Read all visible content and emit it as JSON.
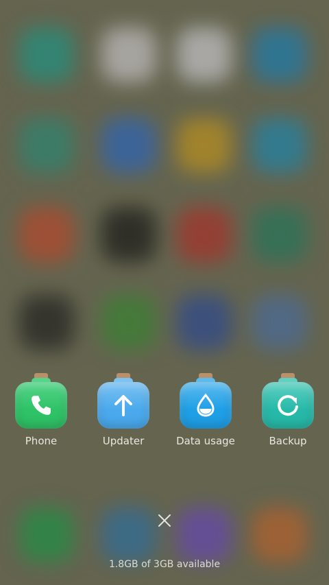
{
  "recent_apps": [
    {
      "label": "Phone",
      "icon": "phone-icon",
      "color": "#2fc266",
      "neck": "#55d48a"
    },
    {
      "label": "Updater",
      "icon": "arrow-up-icon",
      "color": "#4aa9ec",
      "neck": "#7cc2f2"
    },
    {
      "label": "Data usage",
      "icon": "water-drop-icon",
      "color": "#1f9fe6",
      "neck": "#5cbbee"
    },
    {
      "label": "Backup",
      "icon": "refresh-icon",
      "color": "#27b9a8",
      "neck": "#5fd0c2"
    }
  ],
  "close_icon": "close-icon",
  "memory_text": "1.8GB of 3GB available",
  "background_colors": [
    "#1f9c8a",
    "#d0cdd0",
    "#d3d2d8",
    "#1c83b9",
    "#2e8e7a",
    "#2e6bc5",
    "#c79a20",
    "#1f8db5",
    "#c24c2e",
    "#1a1a1a",
    "#b4332c",
    "#257d60",
    "#222222",
    "#3b8b35",
    "#2e4c9a",
    "#4e72a6",
    "#1f9a4a",
    "#2f73a8",
    "#6a4ac0",
    "#c2662e"
  ]
}
